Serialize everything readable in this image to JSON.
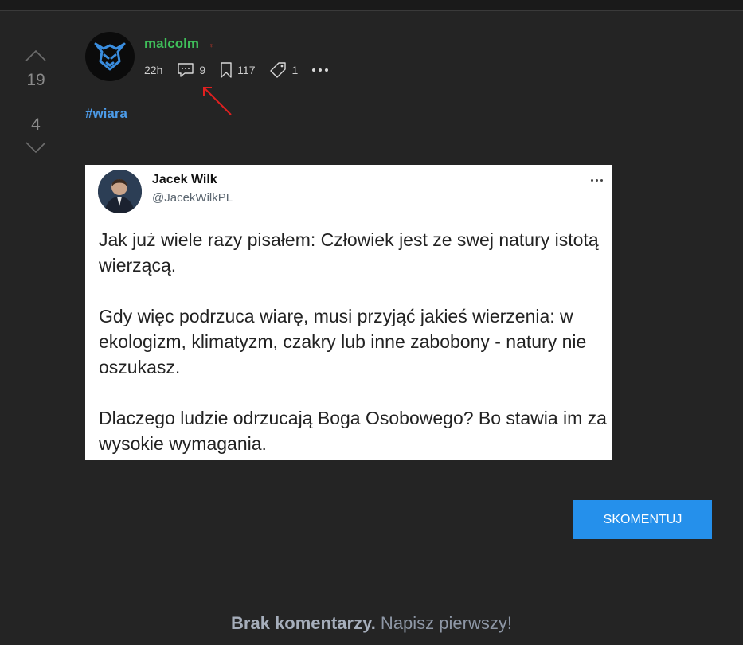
{
  "vote": {
    "up_count": "19",
    "down_count": "4"
  },
  "post": {
    "author": "malcolm",
    "time": "22h",
    "comments": "9",
    "saves": "117",
    "tags_count": "1",
    "tag": "#wiara"
  },
  "tweet": {
    "name": "Jacek Wilk",
    "handle": "@JacekWilkPL",
    "paragraphs": [
      "Jak już wiele razy pisałem: Człowiek jest ze swej natury istotą wierzącą.",
      "Gdy więc podrzuca wiarę, musi przyjąć jakieś wierzenia: w ekologizm, klimatyzm, czakry lub inne zabobony - natury nie oszukasz.",
      "Dlaczego ludzie odrzucają Boga Osobowego? Bo stawia im za wysokie wymagania."
    ]
  },
  "comment_button": "SKOMENTUJ",
  "empty_state": {
    "bold": "Brak komentarzy.",
    "rest": " Napisz pierwszy!"
  },
  "colors": {
    "accent": "#2590eb",
    "author": "#3fbf5a",
    "tag": "#4c9be8",
    "annotation_arrow": "#e02020"
  }
}
